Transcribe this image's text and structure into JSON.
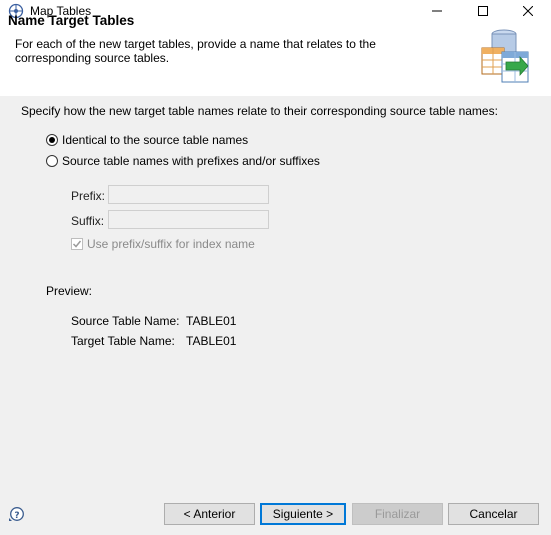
{
  "window": {
    "title": "Map Tables",
    "icon": "map-tables-app-icon",
    "controls": [
      "minimize",
      "maximize",
      "close"
    ]
  },
  "header": {
    "title": "Name Target Tables",
    "description": "For each of the new target tables, provide a name that relates to the corresponding source tables.",
    "icon": "database-tables-wizard-icon"
  },
  "main": {
    "instruction": "Specify how the new target table names relate to their corresponding source table names:",
    "options": [
      {
        "label": "Identical to the source table names",
        "selected": true
      },
      {
        "label": "Source table names with prefixes and/or suffixes",
        "selected": false
      }
    ],
    "prefix": {
      "label": "Prefix:",
      "value": "",
      "enabled": false
    },
    "suffix": {
      "label": "Suffix:",
      "value": "",
      "enabled": false
    },
    "index_checkbox": {
      "label": "Use prefix/suffix for index name",
      "checked": true,
      "enabled": false
    },
    "preview": {
      "heading": "Preview:",
      "source_label": "Source Table Name:",
      "source_value": "TABLE01",
      "target_label": "Target Table Name:",
      "target_value": "TABLE01"
    }
  },
  "footer": {
    "help_icon": "help-icon",
    "back_label": "< Anterior",
    "next_label": "Siguiente >",
    "finish_label": "Finalizar",
    "cancel_label": "Cancelar"
  }
}
